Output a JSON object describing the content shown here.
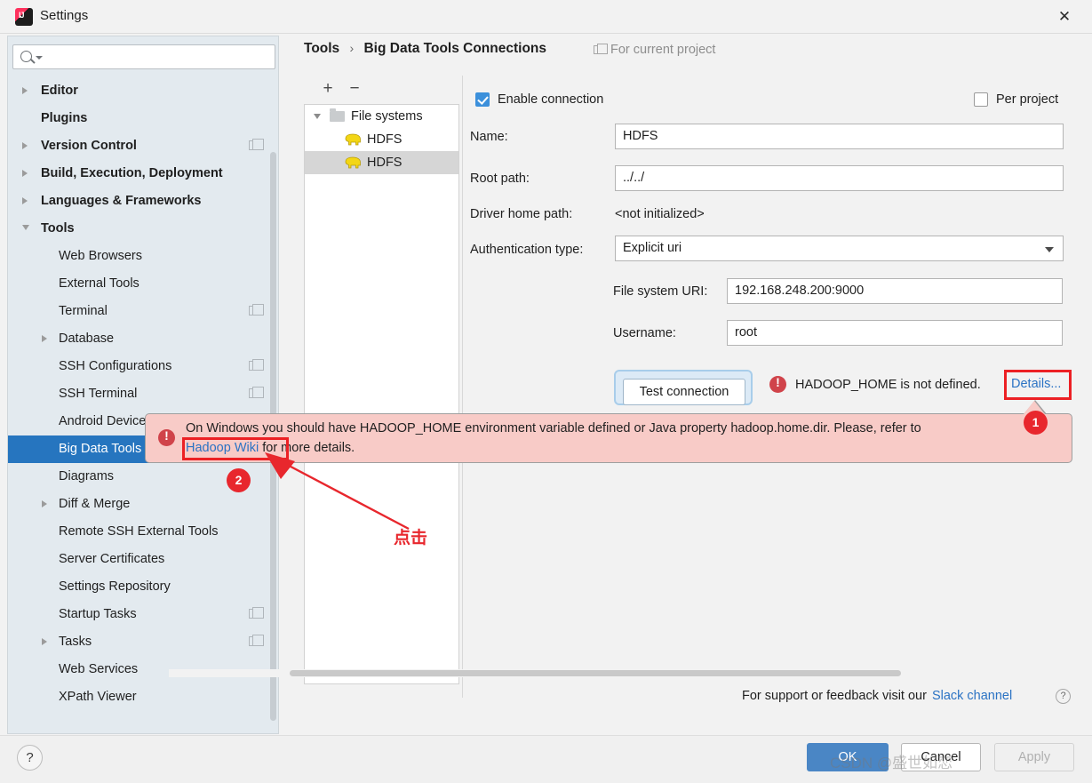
{
  "window": {
    "title": "Settings",
    "app_icon": "intellij-idea-icon",
    "close_icon": "close-icon"
  },
  "sidebar": {
    "search": {
      "placeholder": "",
      "value": "",
      "icon": "search-icon"
    },
    "partial_item_above": "",
    "items": [
      {
        "label": "Editor",
        "level": 0,
        "expandable": true,
        "expanded": false,
        "copy_icon": false
      },
      {
        "label": "Plugins",
        "level": 0,
        "expandable": false,
        "expanded": false,
        "copy_icon": false
      },
      {
        "label": "Version Control",
        "level": 0,
        "expandable": true,
        "expanded": false,
        "copy_icon": true
      },
      {
        "label": "Build, Execution, Deployment",
        "level": 0,
        "expandable": true,
        "expanded": false,
        "copy_icon": false
      },
      {
        "label": "Languages & Frameworks",
        "level": 0,
        "expandable": true,
        "expanded": false,
        "copy_icon": false
      },
      {
        "label": "Tools",
        "level": 0,
        "expandable": true,
        "expanded": true,
        "copy_icon": false
      },
      {
        "label": "Web Browsers",
        "level": 1,
        "expandable": false,
        "expanded": false,
        "copy_icon": false
      },
      {
        "label": "External Tools",
        "level": 1,
        "expandable": false,
        "expanded": false,
        "copy_icon": false
      },
      {
        "label": "Terminal",
        "level": 1,
        "expandable": false,
        "expanded": false,
        "copy_icon": true
      },
      {
        "label": "Database",
        "level": 1,
        "expandable": true,
        "expanded": false,
        "copy_icon": false
      },
      {
        "label": "SSH Configurations",
        "level": 1,
        "expandable": false,
        "expanded": false,
        "copy_icon": true
      },
      {
        "label": "SSH Terminal",
        "level": 1,
        "expandable": false,
        "expanded": false,
        "copy_icon": true
      },
      {
        "label": "Android Device",
        "level": 1,
        "expandable": false,
        "expanded": false,
        "copy_icon": false
      },
      {
        "label": "Big Data Tools Connections",
        "level": 1,
        "expandable": false,
        "expanded": false,
        "copy_icon": true,
        "selected": true
      },
      {
        "label": "Diagrams",
        "level": 1,
        "expandable": false,
        "expanded": false,
        "copy_icon": false
      },
      {
        "label": "Diff & Merge",
        "level": 1,
        "expandable": true,
        "expanded": false,
        "copy_icon": false
      },
      {
        "label": "Remote SSH External Tools",
        "level": 1,
        "expandable": false,
        "expanded": false,
        "copy_icon": false
      },
      {
        "label": "Server Certificates",
        "level": 1,
        "expandable": false,
        "expanded": false,
        "copy_icon": false
      },
      {
        "label": "Settings Repository",
        "level": 1,
        "expandable": false,
        "expanded": false,
        "copy_icon": false
      },
      {
        "label": "Startup Tasks",
        "level": 1,
        "expandable": false,
        "expanded": false,
        "copy_icon": true
      },
      {
        "label": "Tasks",
        "level": 1,
        "expandable": true,
        "expanded": false,
        "copy_icon": true
      },
      {
        "label": "Web Services",
        "level": 1,
        "expandable": false,
        "expanded": false,
        "copy_icon": false
      },
      {
        "label": "XPath Viewer",
        "level": 1,
        "expandable": false,
        "expanded": false,
        "copy_icon": false
      }
    ]
  },
  "breadcrumb": {
    "parent": "Tools",
    "separator": "›",
    "current": "Big Data Tools Connections",
    "for_current_project": "For current project"
  },
  "connections_panel": {
    "add_label": "+",
    "remove_label": "−",
    "rows": [
      {
        "label": "File systems",
        "level": "A",
        "icon": "folder-icon",
        "expanded": true,
        "selected": false
      },
      {
        "label": "HDFS",
        "level": "B",
        "icon": "hadoop-elephant-icon",
        "selected": false
      },
      {
        "label": "HDFS",
        "level": "B",
        "icon": "hadoop-elephant-icon",
        "selected": true
      }
    ]
  },
  "form": {
    "enable_connection": {
      "label": "Enable connection",
      "checked": true
    },
    "per_project": {
      "label": "Per project",
      "checked": false
    },
    "name": {
      "label": "Name:",
      "value": "HDFS"
    },
    "root_path": {
      "label": "Root path:",
      "value": "../../"
    },
    "driver_home_path": {
      "label": "Driver home path:",
      "value": "<not initialized>"
    },
    "authentication_type": {
      "label": "Authentication type:",
      "value": "Explicit uri"
    },
    "file_system_uri": {
      "label": "File system URI:",
      "value": "192.168.248.200:9000"
    },
    "username": {
      "label": "Username:",
      "value": "root"
    },
    "test_connection_button": "Test connection",
    "error_message": "HADOOP_HOME is not defined.",
    "details_link": "Details..."
  },
  "error_popup": {
    "line1": "On Windows you should have HADOOP_HOME environment variable defined or Java property hadoop.home.dir. Please, refer to",
    "link_text": "Hadoop Wiki",
    "line2_rest": "for more details.",
    "icon": "error-icon"
  },
  "annotations": {
    "badge_1": "1",
    "badge_2": "2",
    "click_label": "点击",
    "highlight_color": "#ec2024"
  },
  "support": {
    "text": "For support or feedback visit our",
    "link": "Slack channel",
    "help_icon": "question-mark-icon"
  },
  "footer": {
    "help_label": "?",
    "ok": "OK",
    "cancel": "Cancel",
    "apply": "Apply"
  },
  "watermark": "CSDN @盛世如恋"
}
